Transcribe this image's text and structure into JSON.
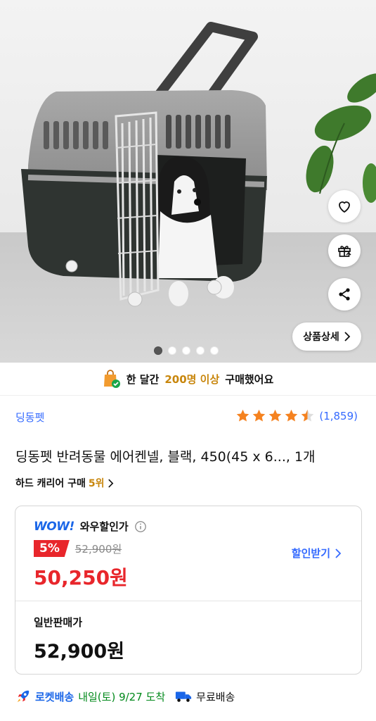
{
  "hero": {
    "detail_button_label": "상품상세",
    "slide_count": 5,
    "active_slide": 1,
    "icons": [
      "heart-icon",
      "gift-icon",
      "share-icon",
      "chevron-right-icon"
    ]
  },
  "buyers": {
    "prefix": "한 달간",
    "highlight": "200명 이상",
    "suffix": "구매했어요"
  },
  "product": {
    "brand": "딩동펫",
    "rating_stars": 4.5,
    "review_count": "(1,859)",
    "title": "딩동펫 반려동물 에어켄넬, 블랙, 450(45 x 6..., 1개",
    "rank_prefix": "하드 캐리어 구매",
    "rank_value": "5위"
  },
  "price": {
    "wow_logo": "WOW!",
    "wow_label": "와우할인가",
    "discount": "5%",
    "original_price": "52,900원",
    "wow_price": "50,250원",
    "coupon_label": "할인받기",
    "normal_label": "일반판매가",
    "normal_price": "52,900원"
  },
  "delivery": {
    "rocket_label": "로켓배송",
    "date_text": "내일(토) 9/27 도착",
    "free_label": "무료배송"
  },
  "colors": {
    "accent_blue": "#346aff",
    "sale_red": "#e8262b",
    "highlight_orange": "#c8860c",
    "delivery_green": "#00891a",
    "star_orange": "#f5821f"
  }
}
